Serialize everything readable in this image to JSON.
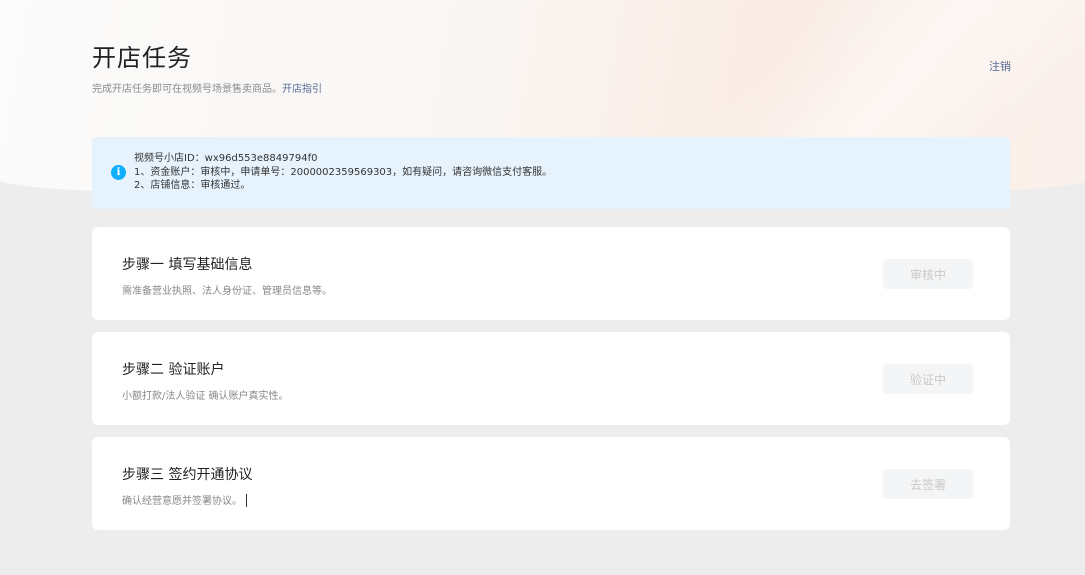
{
  "header": {
    "title": "开店任务",
    "subtitle": "完成开店任务即可在视频号场景售卖商品。",
    "guide_link": "开店指引",
    "logout": "注销"
  },
  "notice": {
    "icon": "info-icon",
    "lines": [
      "视频号小店ID：wx96d553e8849794f0",
      "1、资金账户：审核中，申请单号：2000002359569303，如有疑问，请咨询微信支付客服。",
      "2、店铺信息：审核通过。"
    ]
  },
  "steps": [
    {
      "title": "步骤一 填写基础信息",
      "desc": "需准备营业执照、法人身份证、管理员信息等。",
      "button": "审核中"
    },
    {
      "title": "步骤二 验证账户",
      "desc": "小额打款/法人验证 确认账户真实性。",
      "button": "验证中"
    },
    {
      "title": "步骤三 签约开通协议",
      "desc": "确认经营意愿并签署协议。",
      "button": "去签署"
    }
  ],
  "colors": {
    "link": "#576b95",
    "notice_bg": "#e6f3fd",
    "info_icon": "#10aeff",
    "disabled_button_text": "#c9c9c9"
  }
}
